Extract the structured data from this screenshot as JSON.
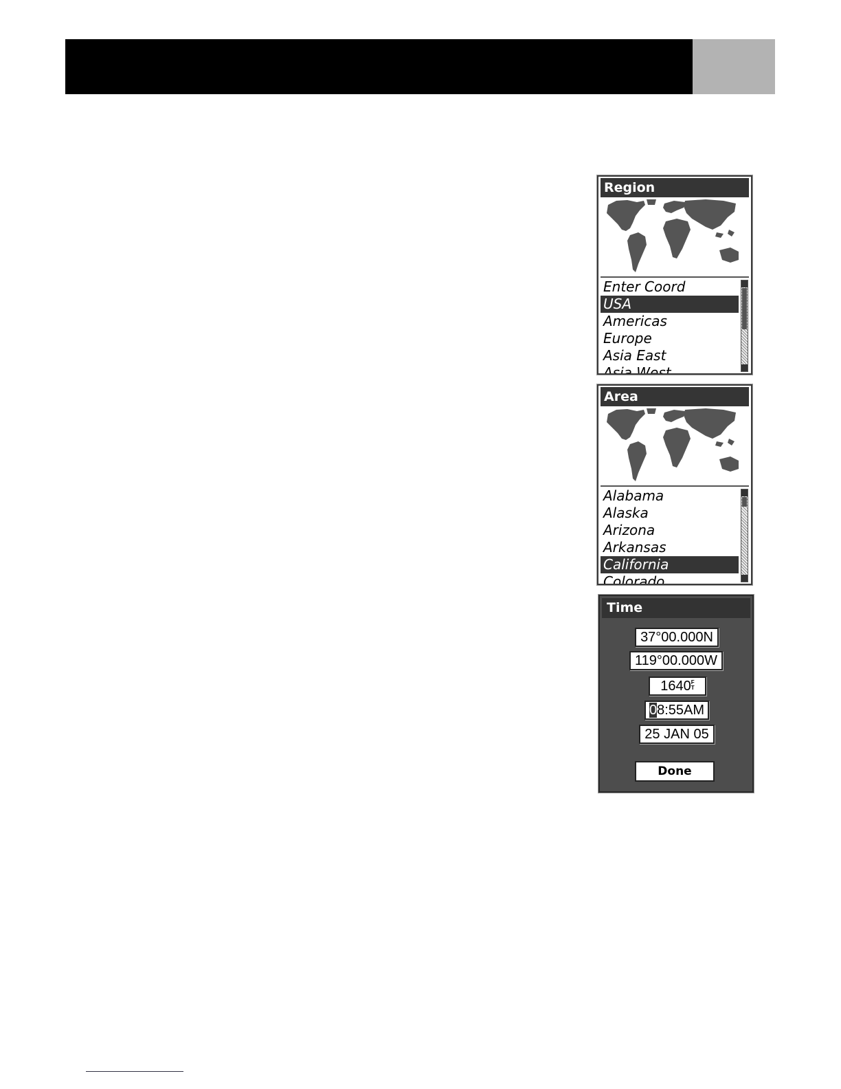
{
  "region_screen": {
    "title": "Region",
    "items": [
      "Enter Coord",
      "USA",
      "Americas",
      "Europe",
      "Asia East",
      "Asia West"
    ],
    "selected_index": 1,
    "scroll_fraction": 0.05
  },
  "area_screen": {
    "title": "Area",
    "items": [
      "Alabama",
      "Alaska",
      "Arizona",
      "Arkansas",
      "California",
      "Colorado"
    ],
    "selected_index": 4,
    "scroll_fraction": 0.0
  },
  "time_screen": {
    "title": "Time",
    "latitude": "37°00.000N",
    "longitude": "119°00.000W",
    "elevation": "1640",
    "elevation_unit_top": "F",
    "elevation_unit_bottom": "T",
    "time_cursor_char": "0",
    "time_rest": "8:55AM",
    "date": "25 JAN 05",
    "done_label": "Done"
  },
  "colors": {
    "header": "#000000",
    "header_tab": "#b3b3b3",
    "title_bar": "#353535",
    "time_background": "#4d4d4d",
    "land": "#555555"
  }
}
